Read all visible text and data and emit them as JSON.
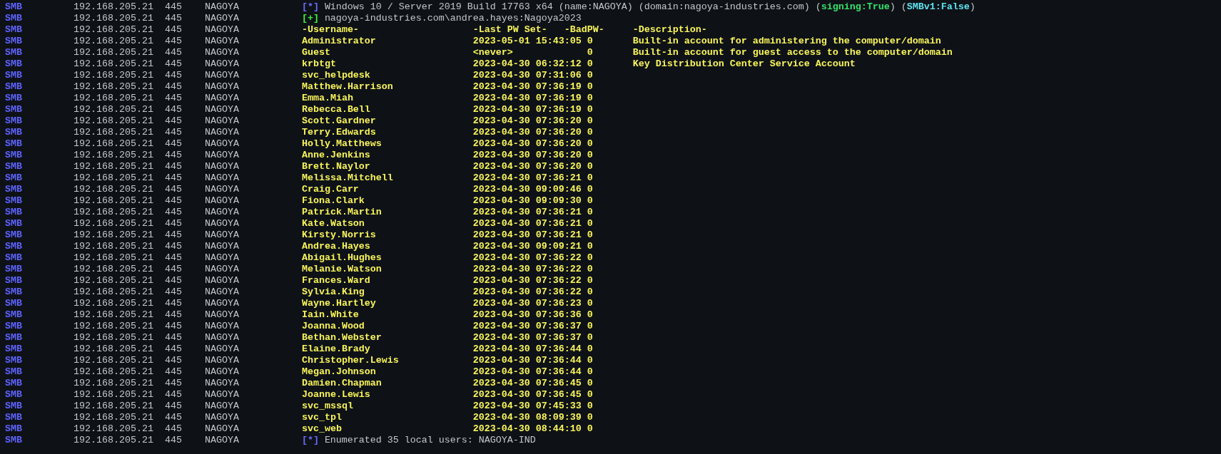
{
  "lines": [
    {
      "kind": "info",
      "protocol": "SMB",
      "ip": "192.168.205.21",
      "port": "445",
      "host": "NAGOYA",
      "marker": "[*]",
      "segments": [
        {
          "kind": "plain",
          "text": "Windows 10 / Server 2019 Build 17763 x64 (name:NAGOYA) (domain:nagoya-industries.com) ("
        },
        {
          "kind": "good",
          "text": "signing:True"
        },
        {
          "kind": "plain",
          "text": ") ("
        },
        {
          "kind": "notice",
          "text": "SMBv1:False"
        },
        {
          "kind": "plain",
          "text": ")"
        }
      ]
    },
    {
      "kind": "success",
      "protocol": "SMB",
      "ip": "192.168.205.21",
      "port": "445",
      "host": "NAGOYA",
      "marker": "[+]",
      "segments": [
        {
          "kind": "plain",
          "text": "nagoya-industries.com\\andrea.hayes:Nagoya2023"
        }
      ]
    },
    {
      "kind": "header",
      "protocol": "SMB",
      "ip": "192.168.205.21",
      "port": "445",
      "host": "NAGOYA",
      "username": "-Username-",
      "last_pw_set": "-Last PW Set-",
      "bad_pw": "-BadPW-",
      "description": "-Description-"
    },
    {
      "kind": "user",
      "protocol": "SMB",
      "ip": "192.168.205.21",
      "port": "445",
      "host": "NAGOYA",
      "username": "Administrator",
      "last_pw_set": "2023-05-01 15:43:05",
      "bad_pw": "0",
      "description": "Built-in account for administering the computer/domain"
    },
    {
      "kind": "user",
      "protocol": "SMB",
      "ip": "192.168.205.21",
      "port": "445",
      "host": "NAGOYA",
      "username": "Guest",
      "last_pw_set": "<never>",
      "bad_pw": "0",
      "description": "Built-in account for guest access to the computer/domain"
    },
    {
      "kind": "user",
      "protocol": "SMB",
      "ip": "192.168.205.21",
      "port": "445",
      "host": "NAGOYA",
      "username": "krbtgt",
      "last_pw_set": "2023-04-30 06:32:12",
      "bad_pw": "0",
      "description": "Key Distribution Center Service Account"
    },
    {
      "kind": "user",
      "protocol": "SMB",
      "ip": "192.168.205.21",
      "port": "445",
      "host": "NAGOYA",
      "username": "svc_helpdesk",
      "last_pw_set": "2023-04-30 07:31:06",
      "bad_pw": "0"
    },
    {
      "kind": "user",
      "protocol": "SMB",
      "ip": "192.168.205.21",
      "port": "445",
      "host": "NAGOYA",
      "username": "Matthew.Harrison",
      "last_pw_set": "2023-04-30 07:36:19",
      "bad_pw": "0"
    },
    {
      "kind": "user",
      "protocol": "SMB",
      "ip": "192.168.205.21",
      "port": "445",
      "host": "NAGOYA",
      "username": "Emma.Miah",
      "last_pw_set": "2023-04-30 07:36:19",
      "bad_pw": "0"
    },
    {
      "kind": "user",
      "protocol": "SMB",
      "ip": "192.168.205.21",
      "port": "445",
      "host": "NAGOYA",
      "username": "Rebecca.Bell",
      "last_pw_set": "2023-04-30 07:36:19",
      "bad_pw": "0"
    },
    {
      "kind": "user",
      "protocol": "SMB",
      "ip": "192.168.205.21",
      "port": "445",
      "host": "NAGOYA",
      "username": "Scott.Gardner",
      "last_pw_set": "2023-04-30 07:36:20",
      "bad_pw": "0"
    },
    {
      "kind": "user",
      "protocol": "SMB",
      "ip": "192.168.205.21",
      "port": "445",
      "host": "NAGOYA",
      "username": "Terry.Edwards",
      "last_pw_set": "2023-04-30 07:36:20",
      "bad_pw": "0"
    },
    {
      "kind": "user",
      "protocol": "SMB",
      "ip": "192.168.205.21",
      "port": "445",
      "host": "NAGOYA",
      "username": "Holly.Matthews",
      "last_pw_set": "2023-04-30 07:36:20",
      "bad_pw": "0"
    },
    {
      "kind": "user",
      "protocol": "SMB",
      "ip": "192.168.205.21",
      "port": "445",
      "host": "NAGOYA",
      "username": "Anne.Jenkins",
      "last_pw_set": "2023-04-30 07:36:20",
      "bad_pw": "0"
    },
    {
      "kind": "user",
      "protocol": "SMB",
      "ip": "192.168.205.21",
      "port": "445",
      "host": "NAGOYA",
      "username": "Brett.Naylor",
      "last_pw_set": "2023-04-30 07:36:20",
      "bad_pw": "0"
    },
    {
      "kind": "user",
      "protocol": "SMB",
      "ip": "192.168.205.21",
      "port": "445",
      "host": "NAGOYA",
      "username": "Melissa.Mitchell",
      "last_pw_set": "2023-04-30 07:36:21",
      "bad_pw": "0"
    },
    {
      "kind": "user",
      "protocol": "SMB",
      "ip": "192.168.205.21",
      "port": "445",
      "host": "NAGOYA",
      "username": "Craig.Carr",
      "last_pw_set": "2023-04-30 09:09:46",
      "bad_pw": "0"
    },
    {
      "kind": "user",
      "protocol": "SMB",
      "ip": "192.168.205.21",
      "port": "445",
      "host": "NAGOYA",
      "username": "Fiona.Clark",
      "last_pw_set": "2023-04-30 09:09:30",
      "bad_pw": "0"
    },
    {
      "kind": "user",
      "protocol": "SMB",
      "ip": "192.168.205.21",
      "port": "445",
      "host": "NAGOYA",
      "username": "Patrick.Martin",
      "last_pw_set": "2023-04-30 07:36:21",
      "bad_pw": "0"
    },
    {
      "kind": "user",
      "protocol": "SMB",
      "ip": "192.168.205.21",
      "port": "445",
      "host": "NAGOYA",
      "username": "Kate.Watson",
      "last_pw_set": "2023-04-30 07:36:21",
      "bad_pw": "0"
    },
    {
      "kind": "user",
      "protocol": "SMB",
      "ip": "192.168.205.21",
      "port": "445",
      "host": "NAGOYA",
      "username": "Kirsty.Norris",
      "last_pw_set": "2023-04-30 07:36:21",
      "bad_pw": "0"
    },
    {
      "kind": "user",
      "protocol": "SMB",
      "ip": "192.168.205.21",
      "port": "445",
      "host": "NAGOYA",
      "username": "Andrea.Hayes",
      "last_pw_set": "2023-04-30 09:09:21",
      "bad_pw": "0"
    },
    {
      "kind": "user",
      "protocol": "SMB",
      "ip": "192.168.205.21",
      "port": "445",
      "host": "NAGOYA",
      "username": "Abigail.Hughes",
      "last_pw_set": "2023-04-30 07:36:22",
      "bad_pw": "0"
    },
    {
      "kind": "user",
      "protocol": "SMB",
      "ip": "192.168.205.21",
      "port": "445",
      "host": "NAGOYA",
      "username": "Melanie.Watson",
      "last_pw_set": "2023-04-30 07:36:22",
      "bad_pw": "0"
    },
    {
      "kind": "user",
      "protocol": "SMB",
      "ip": "192.168.205.21",
      "port": "445",
      "host": "NAGOYA",
      "username": "Frances.Ward",
      "last_pw_set": "2023-04-30 07:36:22",
      "bad_pw": "0"
    },
    {
      "kind": "user",
      "protocol": "SMB",
      "ip": "192.168.205.21",
      "port": "445",
      "host": "NAGOYA",
      "username": "Sylvia.King",
      "last_pw_set": "2023-04-30 07:36:22",
      "bad_pw": "0"
    },
    {
      "kind": "user",
      "protocol": "SMB",
      "ip": "192.168.205.21",
      "port": "445",
      "host": "NAGOYA",
      "username": "Wayne.Hartley",
      "last_pw_set": "2023-04-30 07:36:23",
      "bad_pw": "0"
    },
    {
      "kind": "user",
      "protocol": "SMB",
      "ip": "192.168.205.21",
      "port": "445",
      "host": "NAGOYA",
      "username": "Iain.White",
      "last_pw_set": "2023-04-30 07:36:36",
      "bad_pw": "0"
    },
    {
      "kind": "user",
      "protocol": "SMB",
      "ip": "192.168.205.21",
      "port": "445",
      "host": "NAGOYA",
      "username": "Joanna.Wood",
      "last_pw_set": "2023-04-30 07:36:37",
      "bad_pw": "0"
    },
    {
      "kind": "user",
      "protocol": "SMB",
      "ip": "192.168.205.21",
      "port": "445",
      "host": "NAGOYA",
      "username": "Bethan.Webster",
      "last_pw_set": "2023-04-30 07:36:37",
      "bad_pw": "0"
    },
    {
      "kind": "user",
      "protocol": "SMB",
      "ip": "192.168.205.21",
      "port": "445",
      "host": "NAGOYA",
      "username": "Elaine.Brady",
      "last_pw_set": "2023-04-30 07:36:44",
      "bad_pw": "0"
    },
    {
      "kind": "user",
      "protocol": "SMB",
      "ip": "192.168.205.21",
      "port": "445",
      "host": "NAGOYA",
      "username": "Christopher.Lewis",
      "last_pw_set": "2023-04-30 07:36:44",
      "bad_pw": "0"
    },
    {
      "kind": "user",
      "protocol": "SMB",
      "ip": "192.168.205.21",
      "port": "445",
      "host": "NAGOYA",
      "username": "Megan.Johnson",
      "last_pw_set": "2023-04-30 07:36:44",
      "bad_pw": "0"
    },
    {
      "kind": "user",
      "protocol": "SMB",
      "ip": "192.168.205.21",
      "port": "445",
      "host": "NAGOYA",
      "username": "Damien.Chapman",
      "last_pw_set": "2023-04-30 07:36:45",
      "bad_pw": "0"
    },
    {
      "kind": "user",
      "protocol": "SMB",
      "ip": "192.168.205.21",
      "port": "445",
      "host": "NAGOYA",
      "username": "Joanne.Lewis",
      "last_pw_set": "2023-04-30 07:36:45",
      "bad_pw": "0"
    },
    {
      "kind": "user",
      "protocol": "SMB",
      "ip": "192.168.205.21",
      "port": "445",
      "host": "NAGOYA",
      "username": "svc_mssql",
      "last_pw_set": "2023-04-30 07:45:33",
      "bad_pw": "0"
    },
    {
      "kind": "user",
      "protocol": "SMB",
      "ip": "192.168.205.21",
      "port": "445",
      "host": "NAGOYA",
      "username": "svc_tpl",
      "last_pw_set": "2023-04-30 08:09:39",
      "bad_pw": "0"
    },
    {
      "kind": "user",
      "protocol": "SMB",
      "ip": "192.168.205.21",
      "port": "445",
      "host": "NAGOYA",
      "username": "svc_web",
      "last_pw_set": "2023-04-30 08:44:10",
      "bad_pw": "0"
    },
    {
      "kind": "info",
      "protocol": "SMB",
      "ip": "192.168.205.21",
      "port": "445",
      "host": "NAGOYA",
      "marker": "[*]",
      "segments": [
        {
          "kind": "plain",
          "text": "Enumerated 35 local users: NAGOYA-IND"
        }
      ]
    }
  ]
}
